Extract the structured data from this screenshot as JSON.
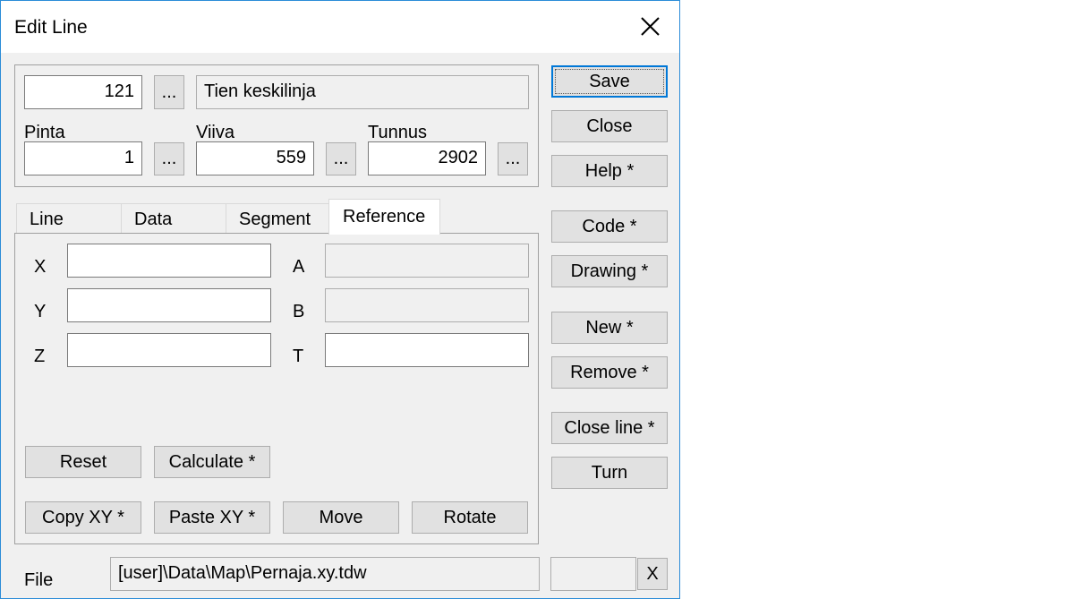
{
  "window": {
    "title": "Edit Line"
  },
  "header": {
    "id_value": "121",
    "browse_label": "...",
    "description": "Tien keskilinja",
    "pinta_label": "Pinta",
    "pinta_value": "1",
    "viiva_label": "Viiva",
    "viiva_value": "559",
    "tunnus_label": "Tunnus",
    "tunnus_value": "2902"
  },
  "tabs": [
    {
      "label": "Line"
    },
    {
      "label": "Data"
    },
    {
      "label": "Segment"
    },
    {
      "label": "Reference"
    }
  ],
  "reference": {
    "x_label": "X",
    "y_label": "Y",
    "z_label": "Z",
    "a_label": "A",
    "b_label": "B",
    "t_label": "T",
    "x_value": "",
    "y_value": "",
    "z_value": "",
    "a_value": "",
    "b_value": "",
    "t_value": "",
    "reset_label": "Reset",
    "calculate_label": "Calculate *",
    "copy_xy_label": "Copy XY *",
    "paste_xy_label": "Paste XY *",
    "move_label": "Move",
    "rotate_label": "Rotate"
  },
  "side_buttons": {
    "save": "Save",
    "close": "Close",
    "help": "Help *",
    "code": "Code *",
    "drawing": "Drawing *",
    "new": "New *",
    "remove": "Remove *",
    "close_line": "Close line *",
    "turn": "Turn"
  },
  "file": {
    "label": "File",
    "path": "[user]\\Data\\Map\\Pernaja.xy.tdw",
    "extra_value": "",
    "clear_label": "X"
  }
}
